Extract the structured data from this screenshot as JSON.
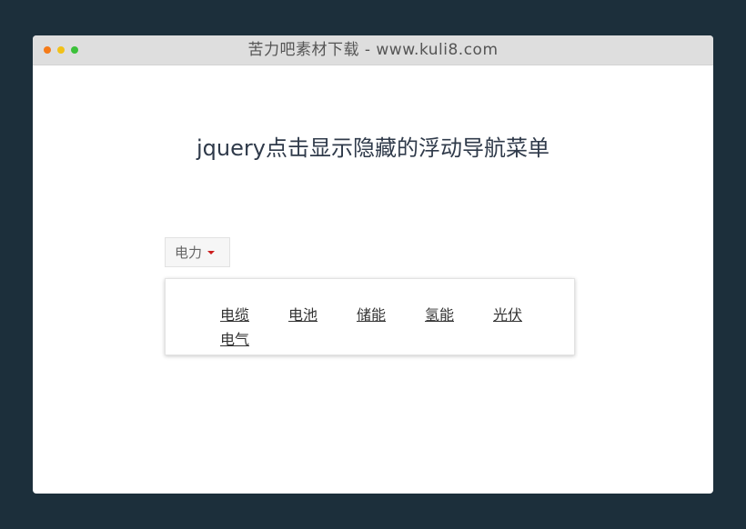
{
  "window": {
    "title": "苦力吧素材下载 - www.kuli8.com",
    "dot_colors": [
      "#f57b19",
      "#f1c119",
      "#3cc13a"
    ]
  },
  "page": {
    "heading": "jquery点击显示隐藏的浮动导航菜单"
  },
  "dropdown": {
    "label": "电力",
    "caret_color": "#cc1d1d",
    "items": [
      {
        "label": "电缆"
      },
      {
        "label": "电池"
      },
      {
        "label": "储能"
      },
      {
        "label": "氢能"
      },
      {
        "label": "光伏"
      },
      {
        "label": "电气"
      }
    ]
  }
}
